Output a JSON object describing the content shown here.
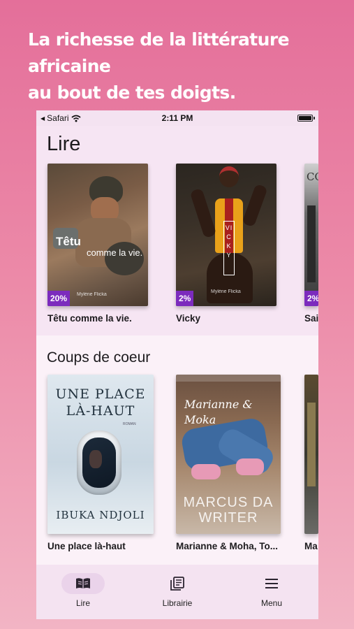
{
  "promo": {
    "line1": "La richesse de la littérature africaine",
    "line2": "au bout de tes doigts."
  },
  "status_bar": {
    "carrier": "Safari",
    "time": "2:11 PM"
  },
  "page_title": "Lire",
  "reading": [
    {
      "title": "Têtu comme la vie.",
      "progress": "20%",
      "cover_title": "Têtu",
      "cover_subtitle": "comme la vie.",
      "cover_author": "Mylène Flicka"
    },
    {
      "title": "Vicky",
      "progress": "2%",
      "cover_title": "VICKY",
      "cover_author": "Mylène Flicka"
    },
    {
      "title": "Sai",
      "progress": "2%",
      "cover_title": "CO"
    }
  ],
  "favorites_title": "Coups de coeur",
  "favorites": [
    {
      "title": "Une place là-haut",
      "cover_title": "UNE PLACE LÀ-HAUT",
      "cover_author": "IBUKA NDJOLI",
      "cover_genre": "ROMAN"
    },
    {
      "title": "Marianne & Moha, To...",
      "cover_title": "Marianne & Moka",
      "cover_author": "MARCUS DA WRITER"
    },
    {
      "title": "Ma"
    }
  ],
  "nav": [
    {
      "label": "Lire",
      "icon": "book-open-icon",
      "active": true
    },
    {
      "label": "Librairie",
      "icon": "library-icon",
      "active": false
    },
    {
      "label": "Menu",
      "icon": "hamburger-menu-icon",
      "active": false
    }
  ],
  "colors": {
    "badge": "#7c2bbd",
    "nav_active_pill": "#ead3ea",
    "background_top": "#e46f9a",
    "background_bottom": "#f2b4c4"
  }
}
